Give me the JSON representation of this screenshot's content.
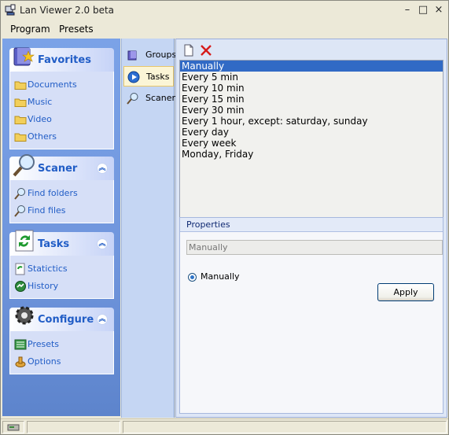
{
  "window": {
    "title": "Lan Viewer 2.0 beta",
    "minimize": "–",
    "maximize": "□",
    "close": "×"
  },
  "menu": {
    "program": "Program",
    "presets": "Presets"
  },
  "sidebar": {
    "favorites": {
      "title": "Favorites",
      "items": [
        "Documents",
        "Music",
        "Video",
        "Others"
      ]
    },
    "scaner": {
      "title": "Scaner",
      "items": [
        "Find folders",
        "Find files"
      ]
    },
    "tasks": {
      "title": "Tasks",
      "items": [
        "Statictics",
        "History"
      ]
    },
    "configure": {
      "title": "Configure",
      "items": [
        "Presets",
        "Options"
      ]
    },
    "collapse_glyph": "︽"
  },
  "tabs": [
    "Groups",
    "Tasks",
    "Scaner"
  ],
  "schedules": [
    "Manually",
    "Every 5 min",
    "Every 10 min",
    "Every 15 min",
    "Every 30 min",
    "Every 1 hour, except: saturday, sunday",
    "Every day",
    "Every week",
    "Monday, Friday"
  ],
  "properties": {
    "header": "Properties",
    "name_value": "Manually",
    "radio_label": "Manually",
    "apply_label": "Apply"
  },
  "colors": {
    "accent": "#215dc6",
    "selection": "#316ac5",
    "panel": "#6f95dc"
  }
}
